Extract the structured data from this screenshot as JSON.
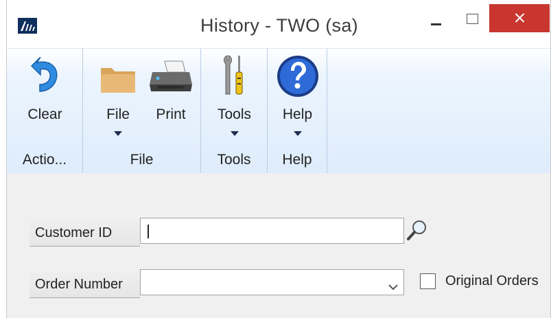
{
  "window": {
    "title": "History  -  TWO (sa)"
  },
  "ribbon": {
    "groups": [
      {
        "label": "Actio...",
        "buttons": [
          {
            "label": "Clear",
            "icon": "undo-icon"
          }
        ]
      },
      {
        "label": "File",
        "buttons": [
          {
            "label": "File",
            "icon": "folder-icon",
            "dropdown": true
          },
          {
            "label": "Print",
            "icon": "printer-icon"
          }
        ]
      },
      {
        "label": "Tools",
        "buttons": [
          {
            "label": "Tools",
            "icon": "tools-icon",
            "dropdown": true
          }
        ]
      },
      {
        "label": "Help",
        "buttons": [
          {
            "label": "Help",
            "icon": "help-icon",
            "dropdown": true
          }
        ]
      }
    ]
  },
  "form": {
    "customer_id": {
      "label": "Customer ID",
      "value": ""
    },
    "order_number": {
      "label": "Order Number",
      "value": ""
    },
    "original_orders": {
      "label": "Original Orders",
      "checked": false
    }
  },
  "colors": {
    "close_button": "#c8362f",
    "ribbon_bg": "#deecfb",
    "form_bg": "#f0f0f0",
    "app_icon": "#0f2f5c"
  }
}
